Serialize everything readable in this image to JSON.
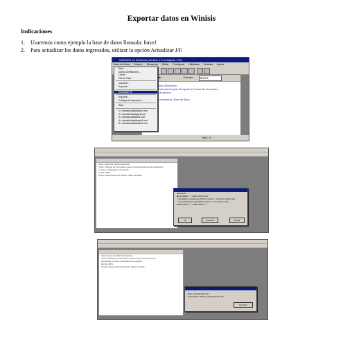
{
  "document": {
    "title": "Exportar datos en Winisis",
    "section_heading": "Indicaciones",
    "steps": [
      {
        "num": "1.",
        "text": "Usaremos como ejemplo la base de datos llamada: ",
        "em": "base1"
      },
      {
        "num": "2.",
        "text": "Para actualizar los datos ingresados, utilizar la opción Actualizar ",
        "em": "I/F."
      }
    ]
  },
  "screenshot1": {
    "window_title": "CDS/ISIS for Windows [Versión 1.3 Completa - ES]",
    "menu": [
      "Base de Datos",
      "Mostrar",
      "Búsqueda",
      "Editar",
      "Configurar",
      "Utilidades",
      "Ventana",
      "Ayuda"
    ],
    "file_menu_items": [
      "Abrir...",
      "Nueva (Definición)...",
      "Cerrar",
      "Cerrar Todo",
      "---",
      "Importar...",
      "Exportar",
      "---",
      "Actualizar I/F",
      "---",
      "Imprimir...",
      "Configurar Impresora...",
      "---",
      "Salir",
      "---",
      "1 c:\\winisis\\data\\base1.mst",
      "2 c:\\winisis\\data\\geni.mst",
      "3 c:\\winisis\\data\\cds.mst",
      "4 c:\\winisis\\data\\base2.mst",
      "5 c:\\winisis\\data\\base3.mst"
    ],
    "selected_item": "Actualizar I/F",
    "format_label": "Formato:",
    "format_value": "BASE1",
    "record_lines": [
      "Espinoza, María Alexandra",
      "Sistema de información para el soporte a la toma de decisiones",
      "Indicadores de gestión",
      "2004",
      "Sistema de información, Base de datos"
    ],
    "status": "MAC: 5"
  },
  "screenshot2": {
    "record_rows": [
      "Autor:  Espinoza, María Alexandra",
      "Título:  Sistema de información para el soporte a la toma de decisiones",
      "         en base a indicadores de gestión",
      "Fecha:  2004",
      "Temas:  Sistema de información, Base de datos"
    ],
    "dialog_lines": [
      "Operación",
      "Actualizar",
      "Actualizar completo del fichero inverso",
      "Re-inicialización del fichero inverso",
      "Crear archivo link",
      "Ordenar archivo link",
      "Leer archivo link",
      "Desde MFN:",
      "Hasta MFN:"
    ],
    "buttons": [
      "Ok",
      "Cancelar",
      "Ayuda"
    ]
  },
  "screenshot3": {
    "record_rows": [
      "Autor:  Espinoza, María Alexandra",
      "Título:  Sistema de información para el soporte a la toma de",
      "         decisiones en base a indicadores de gestión",
      "Fecha:  2004",
      "Temas:  Sistema de información, Base de datos"
    ],
    "dialog_lines": [
      "Base:  Actualización I/F",
      "Procesando:  MFN 5 (Actualización I/F)"
    ],
    "buttons": [
      "Cancelar"
    ]
  },
  "colors": {
    "titlebar": "#0a1a82",
    "chrome": "#d4d0c8",
    "desktop": "#7d7d7d"
  }
}
